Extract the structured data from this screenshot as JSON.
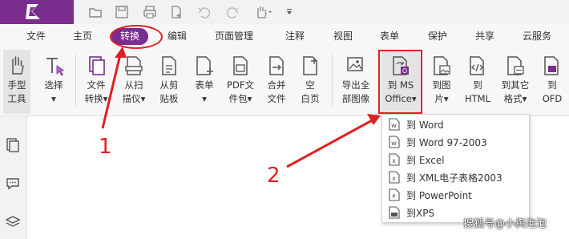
{
  "menubar": {
    "items": [
      "文件",
      "主页",
      "转换",
      "编辑",
      "页面管理",
      "注释",
      "视图",
      "表单",
      "保护",
      "共享",
      "云服务"
    ],
    "active": "转换"
  },
  "ribbon": {
    "hand": {
      "line1": "手型",
      "line2": "工具"
    },
    "select": {
      "line1": "选择"
    },
    "file_convert": {
      "line1": "文件",
      "line2": "转换"
    },
    "from_scan": {
      "line1": "从扫",
      "line2": "描仪"
    },
    "from_clipboard": {
      "line1": "从剪",
      "line2": "贴板"
    },
    "form": {
      "line1": "表单"
    },
    "pdf_package": {
      "line1": "PDF文",
      "line2": "件包"
    },
    "merge": {
      "line1": "合并",
      "line2": "文件"
    },
    "blank": {
      "line1": "空",
      "line2": "白页"
    },
    "export_images": {
      "line1": "导出全",
      "line2": "部图像"
    },
    "to_ms_office": {
      "line1": "到 MS",
      "line2": "Office"
    },
    "to_image": {
      "line1": "到图",
      "line2": "片"
    },
    "to_html": {
      "line1": "到",
      "line2": "HTML"
    },
    "to_other": {
      "line1": "到其它",
      "line2": "格式"
    },
    "to_ofd": {
      "line1": "到",
      "line2": "OFD"
    }
  },
  "dropdown": {
    "items": [
      {
        "label": "到 Word",
        "icon": "word-doc-icon"
      },
      {
        "label": "到 Word 97-2003",
        "icon": "word-doc-icon"
      },
      {
        "label": "到 Excel",
        "icon": "excel-doc-icon"
      },
      {
        "label": "到 XML电子表格2003",
        "icon": "xml-doc-icon"
      },
      {
        "label": "到 PowerPoint",
        "icon": "ppt-doc-icon"
      },
      {
        "label": "到XPS",
        "icon": "xps-doc-icon"
      }
    ]
  },
  "annotations": {
    "num1": "1",
    "num2": "2"
  },
  "watermark": "搜狐号@小舆泡泡",
  "colors": {
    "brand": "#7a2d8f",
    "annotation": "#e02020"
  }
}
